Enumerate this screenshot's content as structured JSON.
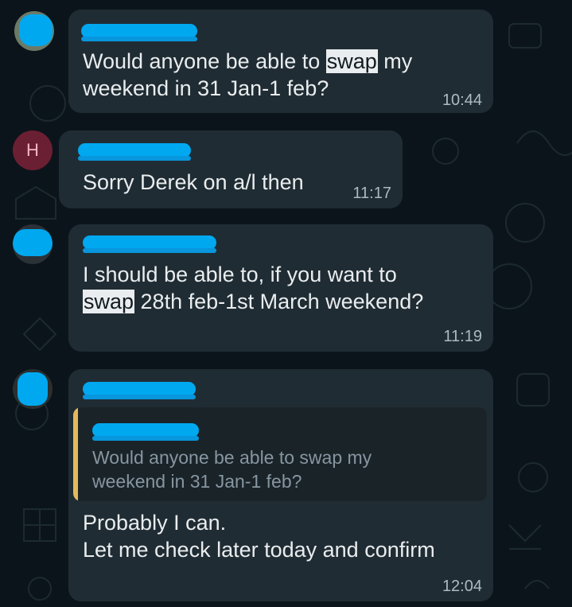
{
  "chat": {
    "messages": [
      {
        "avatar": "photo-avatar",
        "sender": "",
        "text_before": "Would anyone be able to ",
        "highlight": "swap",
        "text_after": " my\nweekend in 31 Jan-1 feb?",
        "time": "10:44"
      },
      {
        "avatar_letter": "H",
        "sender": "",
        "text": "Sorry Derek on a/l then",
        "time": "11:17"
      },
      {
        "avatar": "photo-avatar",
        "sender": "",
        "text_before": "I should be able to, if you want to\n",
        "highlight": "swap",
        "text_after": " 28th feb-1st March weekend?",
        "time": "11:19"
      },
      {
        "avatar": "photo-avatar",
        "sender": "",
        "quote_sender": "",
        "quote_text": "Would anyone be able to swap my\nweekend in 31 Jan-1 feb?",
        "text": "Probably I can.\nLet me check later today and confirm",
        "time": "12:04"
      }
    ]
  },
  "colors": {
    "background": "#0b141a",
    "bubble": "#202c33",
    "redaction": "#00a8f0",
    "quote_bar": "#e5b95b",
    "avatar_h": "#6b1f33"
  }
}
